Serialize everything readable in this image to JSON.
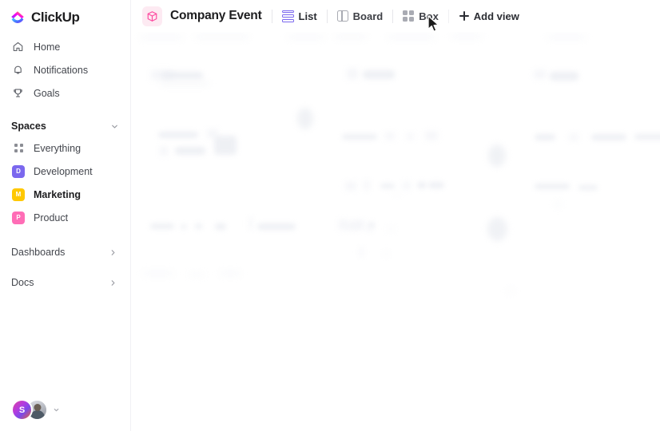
{
  "brand": {
    "name": "ClickUp",
    "logo_icon": "clickup-logo-icon"
  },
  "sidebar": {
    "nav": [
      {
        "label": "Home",
        "icon": "home-icon"
      },
      {
        "label": "Notifications",
        "icon": "bell-icon"
      },
      {
        "label": "Goals",
        "icon": "trophy-icon"
      }
    ],
    "spaces_section": {
      "title": "Spaces",
      "chevron": "chevron-down-icon"
    },
    "spaces": [
      {
        "label": "Everything",
        "badge": "",
        "color": "#8b8d94",
        "icon": "grid-dots-icon",
        "active": false
      },
      {
        "label": "Development",
        "badge": "D",
        "color": "#7B68EE",
        "active": false
      },
      {
        "label": "Marketing",
        "badge": "M",
        "color": "#FFC800",
        "active": true
      },
      {
        "label": "Product",
        "badge": "P",
        "color": "#FF6DB6",
        "active": false
      }
    ],
    "collapsibles": [
      {
        "label": "Dashboards",
        "chevron": "chevron-right-icon"
      },
      {
        "label": "Docs",
        "chevron": "chevron-right-icon"
      }
    ],
    "footer": {
      "avatar_initial": "S",
      "avatar_photo": "user-photo-avatar",
      "caret": "chevron-down-icon"
    }
  },
  "header": {
    "doc_icon": "cube-icon",
    "title": "Company Event",
    "views": [
      {
        "label": "List",
        "icon": "list-rows-icon",
        "active": true
      },
      {
        "label": "Board",
        "icon": "board-columns-icon",
        "active": false
      },
      {
        "label": "Box",
        "icon": "box-grid-icon",
        "active": false
      }
    ],
    "add_view": {
      "label": "Add view",
      "icon": "plus-icon"
    }
  },
  "cursor": {
    "icon": "mouse-pointer-icon"
  },
  "colors": {
    "accent_purple": "#7B68EE",
    "brand_pink": "#FD71AF",
    "text_primary": "#1d1d1f",
    "text_secondary": "#43464d",
    "divider": "#f1f1f4"
  }
}
